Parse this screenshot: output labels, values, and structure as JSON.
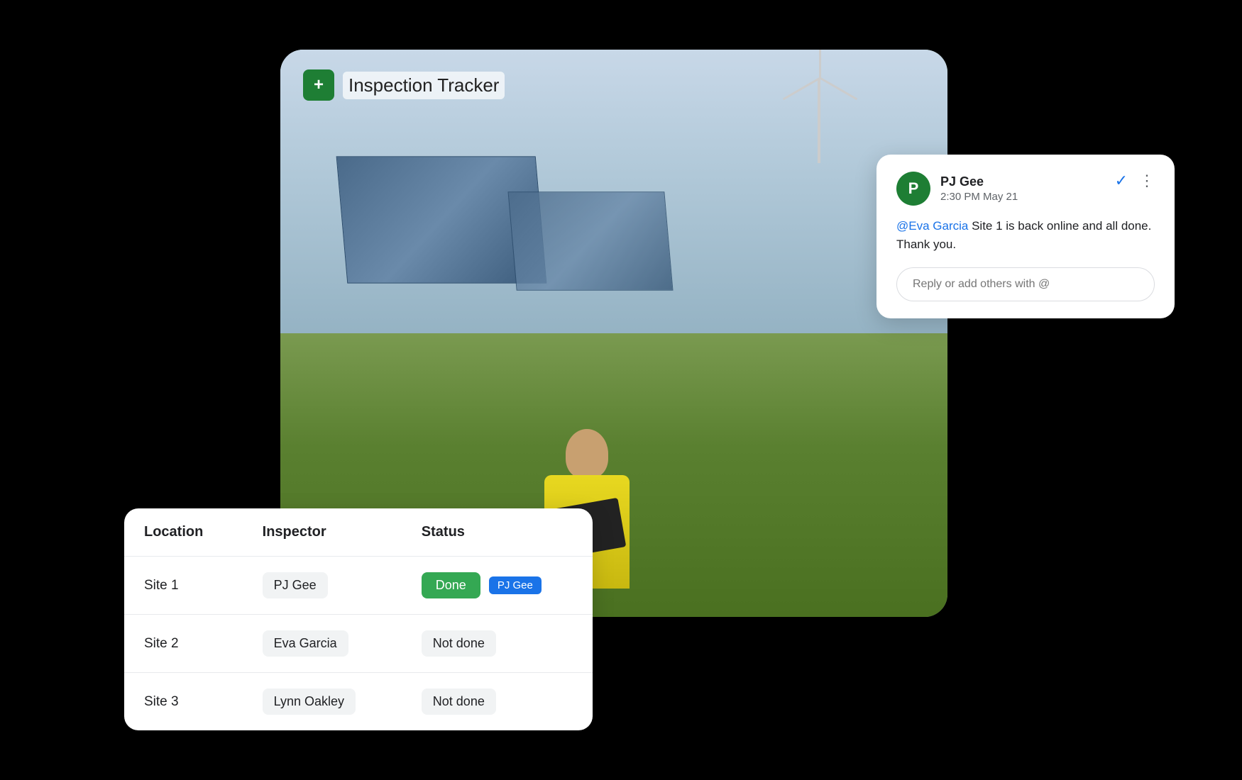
{
  "app": {
    "title": "Inspection Tracker",
    "icon_label": "+"
  },
  "comment_card": {
    "avatar_initial": "P",
    "username": "PJ Gee",
    "timestamp": "2:30 PM May 21",
    "mention": "@Eva Garcia",
    "message_body": " Site 1 is back online and all done. Thank you.",
    "reply_placeholder": "Reply or add others with @",
    "check_icon": "✓",
    "more_icon": "⋮"
  },
  "table": {
    "columns": [
      "Location",
      "Inspector",
      "Status"
    ],
    "rows": [
      {
        "location": "Site 1",
        "inspector": "PJ Gee",
        "status": "Done",
        "status_type": "done",
        "tag": "PJ Gee",
        "show_tag": true
      },
      {
        "location": "Site 2",
        "inspector": "Eva Garcia",
        "status": "Not done",
        "status_type": "not-done",
        "show_tag": false
      },
      {
        "location": "Site 3",
        "inspector": "Lynn Oakley",
        "status": "Not done",
        "status_type": "not-done",
        "show_tag": false
      }
    ]
  }
}
